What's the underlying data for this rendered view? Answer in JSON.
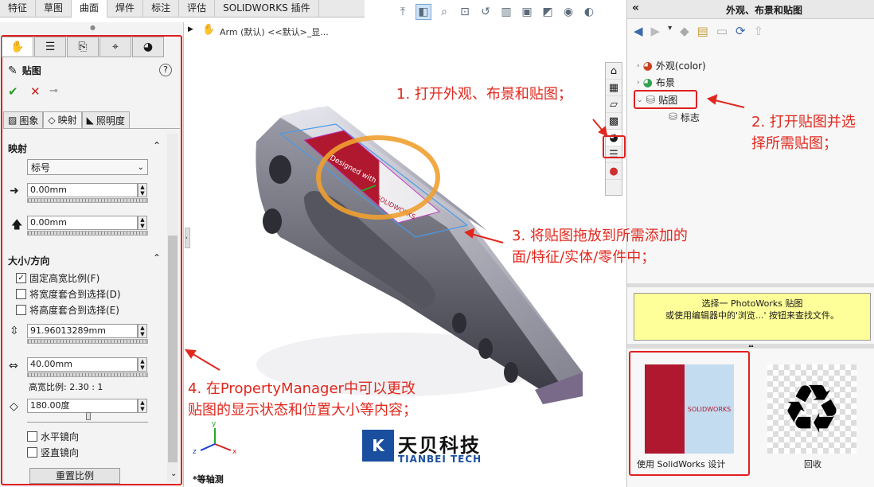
{
  "command_tabs": [
    "特征",
    "草图",
    "曲面",
    "焊件",
    "标注",
    "评估",
    "SOLIDWORKS 插件"
  ],
  "command_tabs_active": 2,
  "breadcrumb": "Arm (默认) <<默认>_显...",
  "property_manager": {
    "title": "贴图",
    "help": "?",
    "ok": "✔",
    "cancel": "✕",
    "pin": "⊸",
    "subtabs": [
      "图象",
      "映射",
      "照明度"
    ],
    "mapping": {
      "section_title": "映射",
      "type_value": "标号",
      "x_offset": "0.00mm",
      "y_offset": "0.00mm"
    },
    "size": {
      "section_title": "大小/方向",
      "fixed_aspect_label": "固定高宽比例(F)",
      "fit_width_label": "将宽度套合到选择(D)",
      "fit_height_label": "将高度套合到选择(E)",
      "height_value": "91.96013289mm",
      "width_value": "40.00mm",
      "aspect_text": "高宽比例: 2.30 : 1",
      "rotation_value": "180.00度",
      "mirror_h_label": "水平镜向",
      "mirror_v_label": "竖直镜向",
      "reset_button": "重置比例"
    }
  },
  "graphics": {
    "view_label": "*等轴测",
    "decal_text": "Designed with",
    "decal_text2": "SOLIDWORKS",
    "logo_cn": "天贝科技",
    "logo_en": "TIANBEI TECH",
    "axis_x": "x",
    "axis_y": "y",
    "axis_z": "z"
  },
  "annotations": {
    "a1": "1. 打开外观、布景和贴图；",
    "a2_line1": "2. 打开贴图并选",
    "a2_line2": "择所需贴图；",
    "a3_line1": "3. 将贴图拖放到所需添加的",
    "a3_line2": "面/特征/实体/零件中；",
    "a4_line1": "4. 在PropertyManager中可以更改",
    "a4_line2": "贴图的显示状态和位置大小等内容；"
  },
  "task_pane": {
    "title": "外观、布景和贴图",
    "collapse": "«",
    "tree": [
      {
        "label": "外观(color)"
      },
      {
        "label": "布景"
      },
      {
        "label": "贴图"
      },
      {
        "label": "标志"
      }
    ],
    "message_line1": "选择一 PhotoWorks 贴图",
    "message_line2": "或使用编辑器中的'浏览...' 按钮来查找文件。",
    "thumbs": [
      {
        "label": "使用 SolidWorks 设计"
      },
      {
        "label": "回收"
      }
    ]
  },
  "colors": {
    "accent_red": "#e0281e",
    "decal_red": "#b0182f",
    "highlight_orange": "#f0a030",
    "message_bg": "#ffff99"
  }
}
